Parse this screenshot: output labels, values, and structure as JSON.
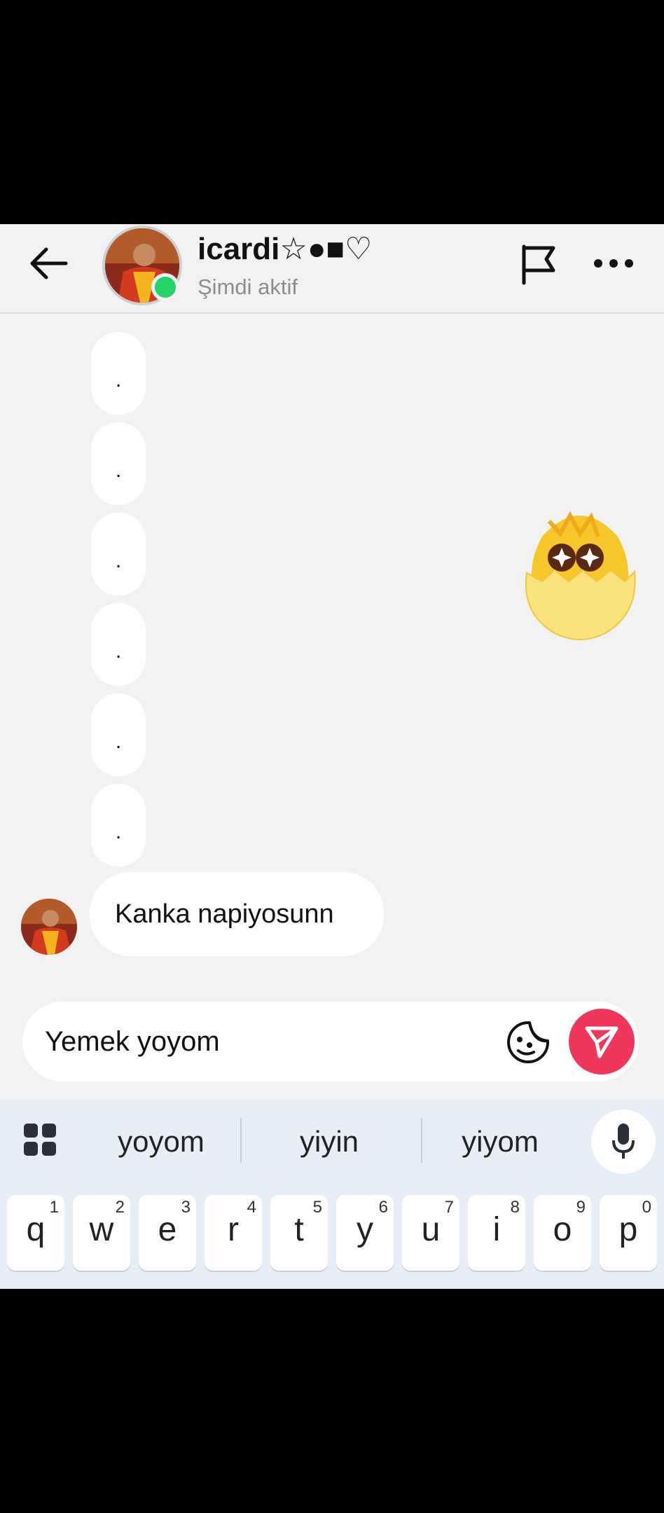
{
  "header": {
    "contact_name": "icardi☆●■♡",
    "status": "Şimdi aktif"
  },
  "messages": {
    "dot_bubbles": [
      ".",
      ".",
      ".",
      ".",
      ".",
      "."
    ],
    "received_text": "Kanka napiyosunn"
  },
  "composer": {
    "value": "Yemek yoyom"
  },
  "keyboard": {
    "suggestions": [
      "yoyom",
      "yiyin",
      "yiyom"
    ],
    "keys": [
      {
        "letter": "q",
        "num": "1"
      },
      {
        "letter": "w",
        "num": "2"
      },
      {
        "letter": "e",
        "num": "3"
      },
      {
        "letter": "r",
        "num": "4"
      },
      {
        "letter": "t",
        "num": "5"
      },
      {
        "letter": "y",
        "num": "6"
      },
      {
        "letter": "u",
        "num": "7"
      },
      {
        "letter": "i",
        "num": "8"
      },
      {
        "letter": "o",
        "num": "9"
      },
      {
        "letter": "p",
        "num": "0"
      }
    ]
  },
  "icons": {
    "back": "arrow-left-icon",
    "report": "flag-icon",
    "more": "more-dots-icon",
    "sticker": "sticker-icon",
    "send": "send-icon",
    "keyboard_menu": "grid-icon",
    "voice": "microphone-icon"
  },
  "colors": {
    "online": "#26d366",
    "send_button": "#f0365a",
    "keyboard_bg": "#e8eef8",
    "chat_bg": "#f2f2f2"
  }
}
